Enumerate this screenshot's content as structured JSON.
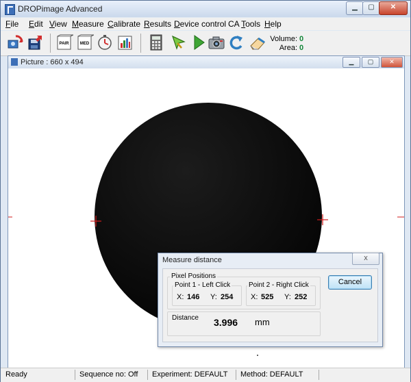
{
  "app": {
    "title": "DROPimage Advanced"
  },
  "menu": [
    {
      "label": "File",
      "u": "F",
      "rest": "ile"
    },
    {
      "label": "Edit",
      "u": "E",
      "rest": "dit"
    },
    {
      "label": "View",
      "u": "V",
      "rest": "iew"
    },
    {
      "label": "Measure",
      "u": "M",
      "rest": "easure"
    },
    {
      "label": "Calibrate",
      "u": "C",
      "rest": "alibrate"
    },
    {
      "label": "Results",
      "u": "R",
      "rest": "esults"
    },
    {
      "label": "Device control",
      "u": "D",
      "rest": "evice control"
    },
    {
      "label": "CA Tools",
      "pre": "CA ",
      "u": "T",
      "rest": "ools"
    },
    {
      "label": "Help",
      "u": "H",
      "rest": "elp"
    }
  ],
  "toolbar": {
    "icons": [
      "open-camera-icon",
      "save-disk-icon",
      "pair-icon",
      "med-icon",
      "timer-icon",
      "results-chart-icon",
      "calculator-icon",
      "arrow-cursor-icon",
      "play-icon",
      "camera-icon",
      "refresh-arrow-icon",
      "eraser-icon"
    ],
    "pair_text": "PAIR",
    "med_text": "MED",
    "volume_label": "Volume:",
    "volume_value": "0",
    "area_label": "Area:",
    "area_value": "0"
  },
  "picture": {
    "title": "Picture : 660 x 494"
  },
  "dialog": {
    "title": "Measure distance",
    "close_label": "x",
    "pixel_positions_label": "Pixel Positions",
    "point1": {
      "label": "Point 1 - Left Click",
      "x_label": "X:",
      "x": "146",
      "y_label": "Y:",
      "y": "254"
    },
    "point2": {
      "label": "Point 2 - Right Click",
      "x_label": "X:",
      "x": "525",
      "y_label": "Y:",
      "y": "252"
    },
    "cancel_label": "Cancel",
    "distance_label": "Distance",
    "distance_value": "3.996",
    "distance_unit": "mm"
  },
  "status": {
    "ready": "Ready",
    "sequence": "Sequence no: Off",
    "experiment": "Experiment: DEFAULT",
    "method": "Method: DEFAULT"
  },
  "colors": {
    "value_green": "#14863a",
    "marker_red": "#d21d1d",
    "drop_black": "#050505"
  }
}
